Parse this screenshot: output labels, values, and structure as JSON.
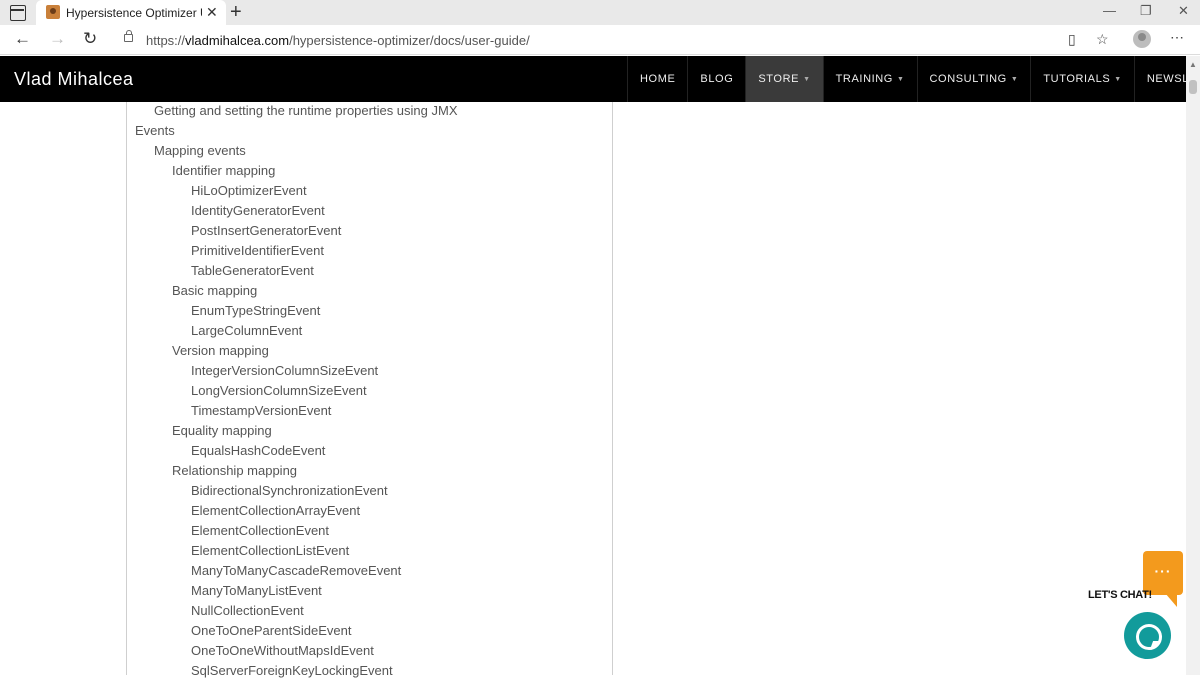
{
  "browser": {
    "tab_title": "Hypersistence Optimizer User Gu",
    "tab_close": "✕",
    "new_tab": "+",
    "minimize": "—",
    "restore": "❐",
    "close": "✕",
    "back": "←",
    "forward": "→",
    "reload": "↻",
    "url_scheme": "https://",
    "url_host": "vladmihalcea.com",
    "url_path": "/hypersistence-optimizer/docs/user-guide/",
    "reader": "▯",
    "favorites": "☆",
    "more": "⋯"
  },
  "site": {
    "brand": "Vlad Mihalcea",
    "menu": [
      {
        "label": "HOME",
        "caret": ""
      },
      {
        "label": "BLOG",
        "caret": ""
      },
      {
        "label": "STORE",
        "caret": "▼"
      },
      {
        "label": "TRAINING",
        "caret": "▼"
      },
      {
        "label": "CONSULTING",
        "caret": "▼"
      },
      {
        "label": "TUTORIALS",
        "caret": "▼"
      },
      {
        "label": "NEWSLETTER",
        "caret": "▼"
      }
    ]
  },
  "toc": [
    {
      "text": "Getting and setting the runtime properties using JMX",
      "level": 1
    },
    {
      "text": "Events",
      "level": 0
    },
    {
      "text": "Mapping events",
      "level": 1
    },
    {
      "text": "Identifier mapping",
      "level": 2
    },
    {
      "text": "HiLoOptimizerEvent",
      "level": 3
    },
    {
      "text": "IdentityGeneratorEvent",
      "level": 3
    },
    {
      "text": "PostInsertGeneratorEvent",
      "level": 3
    },
    {
      "text": "PrimitiveIdentifierEvent",
      "level": 3
    },
    {
      "text": "TableGeneratorEvent",
      "level": 3
    },
    {
      "text": "Basic mapping",
      "level": 2
    },
    {
      "text": "EnumTypeStringEvent",
      "level": 3
    },
    {
      "text": "LargeColumnEvent",
      "level": 3
    },
    {
      "text": "Version mapping",
      "level": 2
    },
    {
      "text": "IntegerVersionColumnSizeEvent",
      "level": 3
    },
    {
      "text": "LongVersionColumnSizeEvent",
      "level": 3
    },
    {
      "text": "TimestampVersionEvent",
      "level": 3
    },
    {
      "text": "Equality mapping",
      "level": 2
    },
    {
      "text": "EqualsHashCodeEvent",
      "level": 3
    },
    {
      "text": "Relationship mapping",
      "level": 2
    },
    {
      "text": "BidirectionalSynchronizationEvent",
      "level": 3
    },
    {
      "text": "ElementCollectionArrayEvent",
      "level": 3
    },
    {
      "text": "ElementCollectionEvent",
      "level": 3
    },
    {
      "text": "ElementCollectionListEvent",
      "level": 3
    },
    {
      "text": "ManyToManyCascadeRemoveEvent",
      "level": 3
    },
    {
      "text": "ManyToManyListEvent",
      "level": 3
    },
    {
      "text": "NullCollectionEvent",
      "level": 3
    },
    {
      "text": "OneToOneParentSideEvent",
      "level": 3
    },
    {
      "text": "OneToOneWithoutMapsIdEvent",
      "level": 3
    },
    {
      "text": "SqlServerForeignKeyLockingEvent",
      "level": 3
    }
  ],
  "chat": {
    "dots": "···",
    "label": "LET'S CHAT!"
  },
  "colors": {
    "header_bg": "#000000",
    "chat_orange": "#f39a1d",
    "chat_teal": "#129b9b"
  }
}
